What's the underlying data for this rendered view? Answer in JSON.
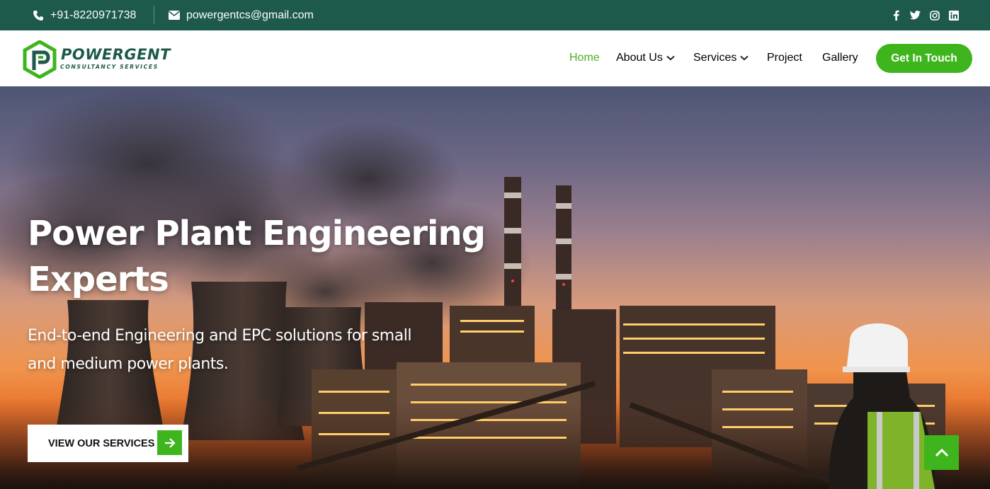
{
  "topbar": {
    "phone": "+91-8220971738",
    "email": "powergentcs@gmail.com",
    "socials": [
      "facebook-icon",
      "twitter-icon",
      "instagram-icon",
      "linkedin-icon"
    ]
  },
  "brand": {
    "name": "POWERGENT",
    "tagline": "CONSULTANCY SERVICES"
  },
  "nav": {
    "items": [
      {
        "label": "Home",
        "active": true,
        "has_dropdown": false
      },
      {
        "label": "About Us",
        "active": false,
        "has_dropdown": true
      },
      {
        "label": "Services",
        "active": false,
        "has_dropdown": true
      },
      {
        "label": "Project",
        "active": false,
        "has_dropdown": false
      },
      {
        "label": "Gallery",
        "active": false,
        "has_dropdown": false
      }
    ],
    "cta_label": "Get In Touch"
  },
  "hero": {
    "title": "Power Plant Engineering Experts",
    "subtitle": "End-to-end Engineering and EPC solutions for small and medium power plants.",
    "button_label": "VIEW OUR SERVICES"
  },
  "colors": {
    "topbar_bg": "#1d5a4b",
    "accent_green": "#3eb51d",
    "active_nav": "#4caf22"
  }
}
